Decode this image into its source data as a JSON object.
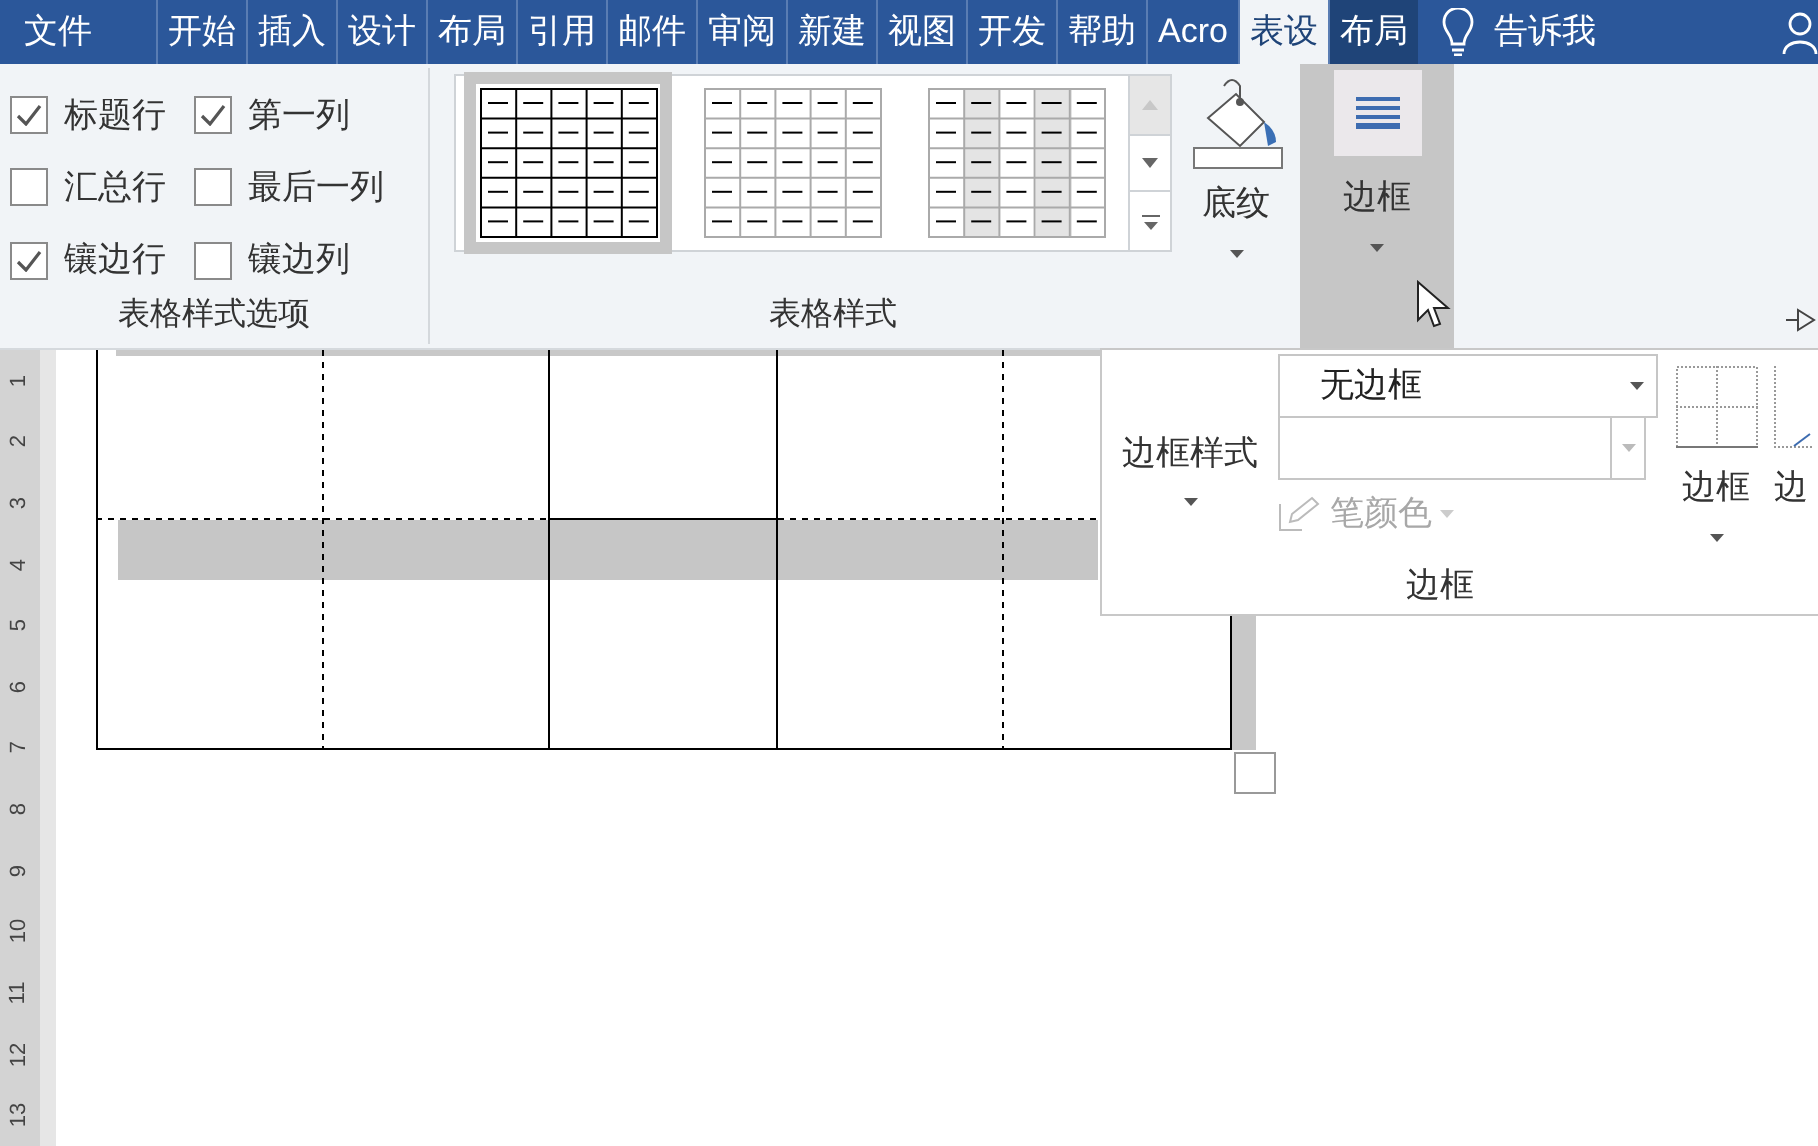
{
  "ribbon_tabs": [
    {
      "label": "文件",
      "selected": false,
      "contextual": false
    },
    {
      "label": "开始",
      "selected": false,
      "contextual": false
    },
    {
      "label": "插入",
      "selected": false,
      "contextual": false
    },
    {
      "label": "设计",
      "selected": false,
      "contextual": false
    },
    {
      "label": "布局",
      "selected": false,
      "contextual": false
    },
    {
      "label": "引用",
      "selected": false,
      "contextual": false
    },
    {
      "label": "邮件",
      "selected": false,
      "contextual": false
    },
    {
      "label": "审阅",
      "selected": false,
      "contextual": false
    },
    {
      "label": "新建",
      "selected": false,
      "contextual": false
    },
    {
      "label": "视图",
      "selected": false,
      "contextual": false
    },
    {
      "label": "开发",
      "selected": false,
      "contextual": false
    },
    {
      "label": "帮助",
      "selected": false,
      "contextual": false
    },
    {
      "label": "Acro",
      "selected": false,
      "contextual": false
    },
    {
      "label": "表设",
      "selected": true,
      "contextual": true
    },
    {
      "label": "布局",
      "selected": false,
      "contextual": true
    }
  ],
  "tell_me": "告诉我",
  "style_options": {
    "items": [
      {
        "label": "标题行",
        "checked": true
      },
      {
        "label": "第一列",
        "checked": true
      },
      {
        "label": "汇总行",
        "checked": false
      },
      {
        "label": "最后一列",
        "checked": false
      },
      {
        "label": "镶边行",
        "checked": true
      },
      {
        "label": "镶边列",
        "checked": false
      }
    ],
    "group_label": "表格样式选项"
  },
  "table_styles": {
    "thumbnails": [
      {
        "kind": "grid",
        "selected": true
      },
      {
        "kind": "light",
        "selected": false
      },
      {
        "kind": "banded",
        "selected": false
      }
    ],
    "shading_button": "底纹",
    "group_label": "表格样式"
  },
  "borders_button": {
    "label": "边框",
    "highlighted": true
  },
  "borders_popup": {
    "border_styles_button": "边框样式",
    "line_style": "无边框",
    "pen_color": {
      "label": "笔颜色",
      "disabled": true
    },
    "borders_button": "边框",
    "cut_button": "边",
    "group_label": "边框"
  },
  "ruler": [
    "1",
    "2",
    "3",
    "4",
    "5",
    "6",
    "7",
    "8",
    "9",
    "10",
    "11",
    "12",
    "13"
  ]
}
